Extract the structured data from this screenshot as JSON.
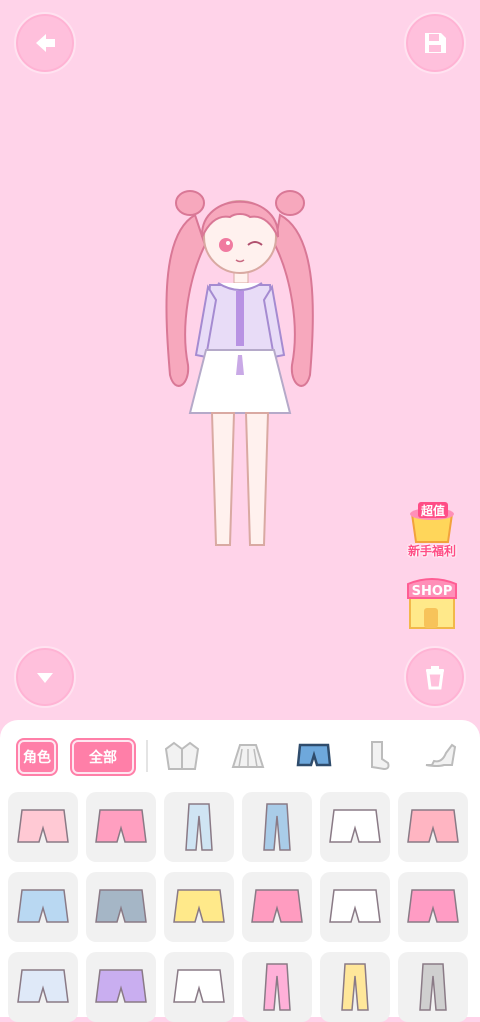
{
  "header": {
    "back_icon": "arrow-left-icon",
    "save_icon": "floppy-disk-icon"
  },
  "side_badges": {
    "welfare_label": "新手福利",
    "welfare_tag": "超值",
    "shop_label": "SHOP"
  },
  "controls": {
    "collapse_icon": "triangle-down-icon",
    "trash_icon": "trash-can-icon"
  },
  "tabs": {
    "character_label": "角色",
    "all_label": "全部",
    "icons": [
      "jacket-icon",
      "skirt-icon",
      "shorts-icon",
      "sock-icon",
      "high-heel-icon"
    ],
    "active": "shorts-icon"
  },
  "items": [
    {
      "name": "pink-ruffle-shorts",
      "color": "#ffc9d4"
    },
    {
      "name": "pink-bloomers",
      "color": "#ff9fc0"
    },
    {
      "name": "light-blue-jeans",
      "color": "#cfe4f3"
    },
    {
      "name": "blue-jeans",
      "color": "#a9cce8"
    },
    {
      "name": "white-heart-shorts",
      "color": "#ffffff"
    },
    {
      "name": "pink-shorts",
      "color": "#ffb5c2"
    },
    {
      "name": "light-denim-shorts",
      "color": "#b9d8f2"
    },
    {
      "name": "grey-denim-shorts",
      "color": "#a5b6c6"
    },
    {
      "name": "yellow-bow-shorts",
      "color": "#ffe98a"
    },
    {
      "name": "pink-lace-skirt",
      "color": "#ff9cc0"
    },
    {
      "name": "bunny-print-bloomers",
      "color": "#ffffff"
    },
    {
      "name": "strawberry-bloomers",
      "color": "#ff9cc4"
    },
    {
      "name": "striped-bow-shorts",
      "color": "#dfe9f8"
    },
    {
      "name": "lilac-bow-shorts",
      "color": "#c9aef0"
    },
    {
      "name": "white-bow-bloomers",
      "color": "#ffffff"
    },
    {
      "name": "pink-wide-pants",
      "color": "#ffb0d8"
    },
    {
      "name": "yellow-heart-pants",
      "color": "#ffe79a"
    },
    {
      "name": "plaid-pants",
      "color": "#cfcfcf"
    }
  ]
}
